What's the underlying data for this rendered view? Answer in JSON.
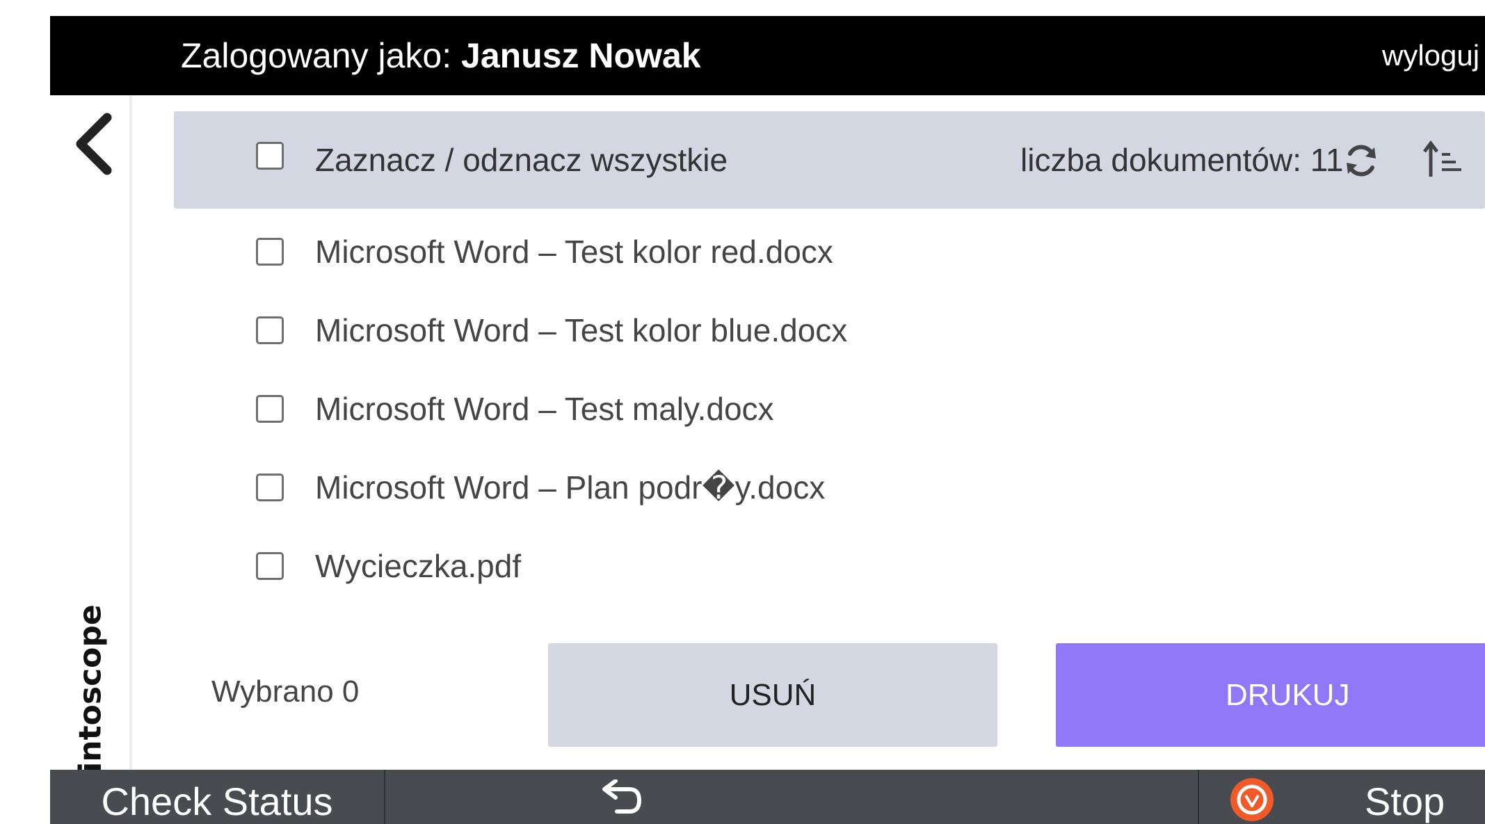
{
  "topbar": {
    "login_prefix": "Zalogowany jako: ",
    "user_name": "Janusz Nowak",
    "logout_label": "wyloguj",
    "background": "#000000"
  },
  "sidebar": {
    "back_icon": "chevron-left-icon",
    "brand": "Printoscope"
  },
  "documents": {
    "select_all_label": "Zaznacz / odznacz wszystkie",
    "count_label": "liczba dokumentów: 11",
    "refresh_icon": "refresh-icon",
    "sort_icon": "sort-ascending-icon",
    "items": [
      {
        "name": "Microsoft Word – Test kolor red.docx",
        "checked": false
      },
      {
        "name": "Microsoft Word – Test kolor blue.docx",
        "checked": false
      },
      {
        "name": "Microsoft Word – Test maly.docx",
        "checked": false
      },
      {
        "name": "Microsoft Word – Plan podr�y.docx",
        "checked": false
      },
      {
        "name": "Wycieczka.pdf",
        "checked": false
      }
    ]
  },
  "actions": {
    "selected_label": "Wybrano 0",
    "delete_label": "USUŃ",
    "print_label": "DRUKUJ",
    "print_color": "#8f78f7",
    "delete_color": "#d3d7e2"
  },
  "system_bar": {
    "check_status_label": "Check Status",
    "undo_icon": "undo-arrow-icon",
    "stop_icon": "stop-hand-icon",
    "stop_label": "Stop",
    "background": "#484b4f",
    "stop_color": "#f05a2a"
  }
}
